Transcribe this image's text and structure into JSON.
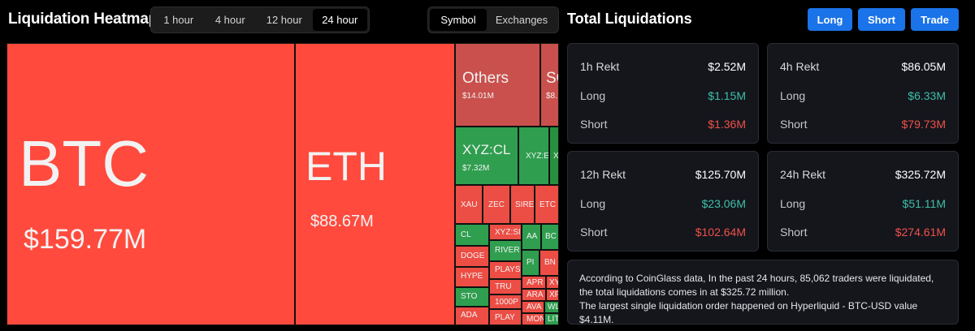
{
  "heatmap": {
    "title": "Liquidation Heatmap",
    "time_options": [
      "1 hour",
      "4 hour",
      "12 hour",
      "24 hour"
    ],
    "time_active": "24 hour",
    "type_options": [
      "Symbol",
      "Exchanges"
    ],
    "type_active": "Symbol"
  },
  "tiles": {
    "btc": {
      "symbol": "BTC",
      "amount": "$159.77M"
    },
    "eth": {
      "symbol": "ETH",
      "amount": "$88.67M"
    },
    "others": {
      "symbol": "Others",
      "amount": "$14.01M"
    },
    "so": {
      "symbol": "SO",
      "amount": "$8."
    },
    "xyzcl": {
      "symbol": "XYZ:CL",
      "amount": "$7.32M"
    },
    "xyze": {
      "symbol": "XYZ:E"
    },
    "x1": {
      "symbol": "X"
    },
    "xau": {
      "symbol": "XAU"
    },
    "zec": {
      "symbol": "ZEC"
    },
    "sire": {
      "symbol": "SIRE"
    },
    "etc": {
      "symbol": "ETC"
    },
    "cl": {
      "symbol": "CL"
    },
    "xyzsi": {
      "symbol": "XYZ:SI"
    },
    "aa": {
      "symbol": "AA"
    },
    "bc": {
      "symbol": "BC"
    },
    "doge": {
      "symbol": "DOGE"
    },
    "river": {
      "symbol": "RIVER"
    },
    "pi": {
      "symbol": "PI"
    },
    "bn": {
      "symbol": "BN"
    },
    "hype": {
      "symbol": "HYPE"
    },
    "plays": {
      "symbol": "PLAYS"
    },
    "apr": {
      "symbol": "APR"
    },
    "xy": {
      "symbol": "XY"
    },
    "sto": {
      "symbol": "STO"
    },
    "tru": {
      "symbol": "TRU"
    },
    "ara": {
      "symbol": "ARA"
    },
    "xf": {
      "symbol": "XF"
    },
    "p1000": {
      "symbol": "1000P"
    },
    "ava": {
      "symbol": "AVA"
    },
    "wl": {
      "symbol": "WL"
    },
    "ada": {
      "symbol": "ADA"
    },
    "play": {
      "symbol": "PLAY"
    },
    "mon": {
      "symbol": "MON"
    },
    "lit": {
      "symbol": "LIT"
    }
  },
  "total": {
    "title": "Total Liquidations",
    "buttons": {
      "long": "Long",
      "short": "Short",
      "trade": "Trade"
    },
    "cards": [
      {
        "label": "1h Rekt",
        "total": "$2.52M",
        "long_label": "Long",
        "long": "$1.15M",
        "short_label": "Short",
        "short": "$1.36M"
      },
      {
        "label": "4h Rekt",
        "total": "$86.05M",
        "long_label": "Long",
        "long": "$6.33M",
        "short_label": "Short",
        "short": "$79.73M"
      },
      {
        "label": "12h Rekt",
        "total": "$125.70M",
        "long_label": "Long",
        "long": "$23.06M",
        "short_label": "Short",
        "short": "$102.64M"
      },
      {
        "label": "24h Rekt",
        "total": "$325.72M",
        "long_label": "Long",
        "long": "$51.11M",
        "short_label": "Short",
        "short": "$274.61M"
      }
    ],
    "info_line1": "According to CoinGlass data, In the past 24 hours, 85,062 traders were liquidated, the total liquidations comes in at $325.72 million.",
    "info_line2": "The largest single liquidation order happened on Hyperliquid - BTC-USD value $4.11M."
  }
}
